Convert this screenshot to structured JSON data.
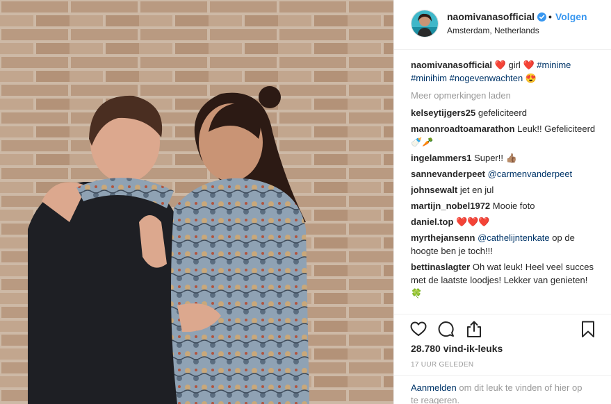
{
  "post": {
    "username": "naomivanasofficial",
    "follow_label": "Volgen",
    "dot": "•",
    "location": "Amsterdam, Netherlands",
    "caption": {
      "username": "naomivanasofficial",
      "heart1": "❤️",
      "word": "girl",
      "heart2": "❤️",
      "tag1": "#minime",
      "tag2": "#minihim",
      "tag3": "#nogevenwachten",
      "emoji": "😍"
    },
    "load_more": "Meer opmerkingen laden",
    "likes": "28.780 vind-ik-leuks",
    "time": "17 UUR GELEDEN",
    "login": {
      "link": "Aanmelden",
      "text": " om dit leuk te vinden of hier op te reageren."
    }
  },
  "comments": [
    {
      "user": "kelseytijgers25",
      "text": "gefeliciteerd"
    },
    {
      "user": "manonroadtoamarathon",
      "text": "Leuk!! Gefeliciteerd🍼🥕"
    },
    {
      "user": "ingelammers1",
      "text": "Super!! 👍🏽"
    },
    {
      "user": "sannevanderpeet",
      "mention": "@carmenvanderpeet"
    },
    {
      "user": "johnsewalt",
      "text": "jet en jul"
    },
    {
      "user": "martijn_nobel1972",
      "text": "Mooie foto"
    },
    {
      "user": "daniel.top",
      "text": "❤️❤️❤️"
    },
    {
      "user": "myrthejansenn",
      "mention": "@cathelijntenkate",
      "text": " op de hoogte ben je toch!!!"
    },
    {
      "user": "bettinaslagter",
      "text": "Oh wat leuk! Heel veel succes met de laatste loodjes! Lekker van genieten! 🍀"
    }
  ],
  "icons": {
    "verified": "verified-badge-icon",
    "like": "heart-outline-icon",
    "comment": "speech-bubble-icon",
    "share": "share-upload-icon",
    "save": "bookmark-icon"
  },
  "colors": {
    "link_blue": "#3897f0",
    "tag_blue": "#003569",
    "muted": "#999999",
    "text": "#262626"
  }
}
